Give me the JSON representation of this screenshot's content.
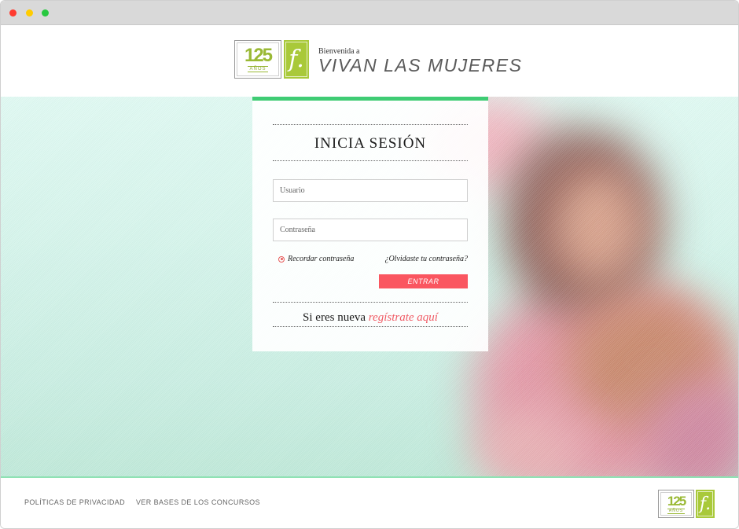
{
  "header": {
    "logo_number": "125",
    "logo_years": "AÑOS",
    "f_logo": "f.",
    "welcome": "Bienvenida a",
    "brand": "VIVAN LAS MUJERES"
  },
  "login": {
    "title": "INICIA SESIÓN",
    "username_placeholder": "Usuario",
    "password_placeholder": "Contraseña",
    "remember_label": "Recordar contraseña",
    "forgot_label": "¿Olvidaste tu contraseña?",
    "submit_label": "ENTRAR",
    "register_prefix": "Si eres nueva",
    "register_link": "regístrate aquí"
  },
  "footer": {
    "privacy": "POLÍTICAS DE PRIVACIDAD",
    "contests": "VER BASES DE LOS CONCURSOS",
    "logo_number": "125",
    "logo_years": "AÑOS",
    "f_logo": "f."
  },
  "colors": {
    "accent_green": "#3fcc74",
    "brand_green": "#a9c93a",
    "button_red": "#fa5660",
    "link_red": "#f05a64"
  },
  "icons": [
    "window-close-icon",
    "window-minimize-icon",
    "window-maximize-icon",
    "radio-icon"
  ]
}
